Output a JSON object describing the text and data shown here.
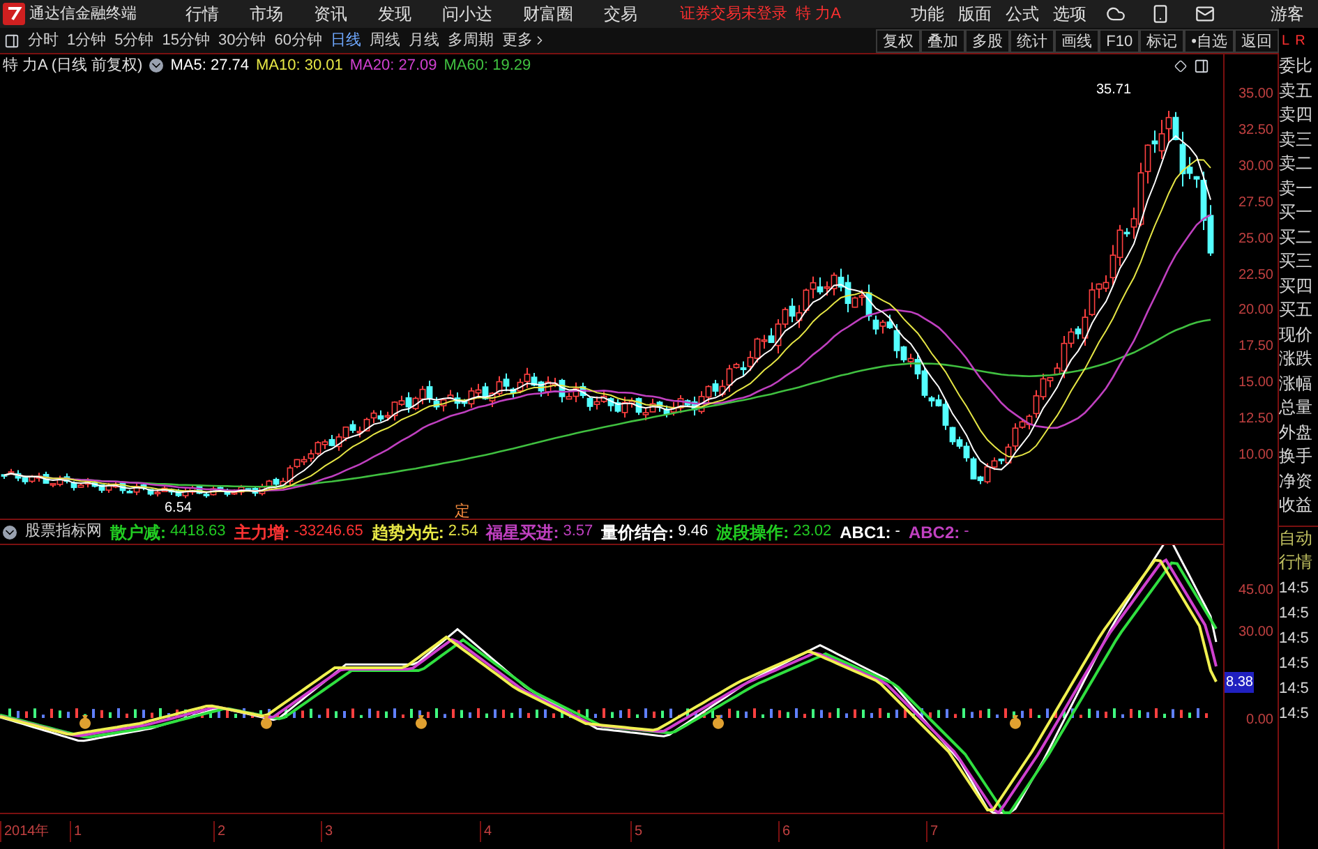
{
  "menu_bar": {
    "app_title": "通达信金融终端",
    "items": [
      "行情",
      "市场",
      "资讯",
      "发现",
      "问小达",
      "财富圈",
      "交易"
    ],
    "login_notice": "证券交易未登录",
    "stock_name": "特 力A",
    "right_items": [
      "功能",
      "版面",
      "公式",
      "选项"
    ],
    "user": "游客"
  },
  "toolbar": {
    "periods": [
      {
        "label": "分时",
        "selected": false
      },
      {
        "label": "1分钟",
        "selected": false
      },
      {
        "label": "5分钟",
        "selected": false
      },
      {
        "label": "15分钟",
        "selected": false
      },
      {
        "label": "30分钟",
        "selected": false
      },
      {
        "label": "60分钟",
        "selected": false
      },
      {
        "label": "日线",
        "selected": true
      },
      {
        "label": "周线",
        "selected": false
      },
      {
        "label": "月线",
        "selected": false
      },
      {
        "label": "多周期",
        "selected": false
      },
      {
        "label": "更多",
        "selected": false
      }
    ],
    "buttons": [
      "复权",
      "叠加",
      "多股",
      "统计",
      "画线",
      "F10",
      "标记",
      "•自选",
      "返回"
    ],
    "corner_labels": [
      "L",
      "R"
    ]
  },
  "chart_header": {
    "title": "特 力A (日线 前复权)",
    "indicators": [
      {
        "label": "MA5: 27.74",
        "color": "#ffffff"
      },
      {
        "label": "MA10: 30.01",
        "color": "#e6e645"
      },
      {
        "label": "MA20: 27.09",
        "color": "#d040d0"
      },
      {
        "label": "MA60: 19.29",
        "color": "#40c040"
      }
    ]
  },
  "annotations": {
    "high": "35.71",
    "low": "6.54",
    "marker": "定"
  },
  "price_axis": [
    "35.00",
    "32.50",
    "30.00",
    "27.50",
    "25.00",
    "22.50",
    "20.00",
    "17.50",
    "15.00",
    "12.50",
    "10.00"
  ],
  "indicator_header": {
    "name": "股票指标网",
    "values": [
      {
        "label": "散户减:",
        "value": "4418.63",
        "color": "#22cc22"
      },
      {
        "label": "主力增:",
        "value": "-33246.65",
        "color": "#ff3333"
      },
      {
        "label": "趋势为先:",
        "value": "2.54",
        "color": "#e6e645"
      },
      {
        "label": "福星买进:",
        "value": "3.57",
        "color": "#c040c0"
      },
      {
        "label": "量价结合:",
        "value": "9.46",
        "color": "#ffffff"
      },
      {
        "label": "波段操作:",
        "value": "23.02",
        "color": "#22cc22"
      },
      {
        "label": "ABC1:",
        "value": "-",
        "color": "#ffffff"
      },
      {
        "label": "ABC2:",
        "value": "-",
        "color": "#c040c0"
      }
    ]
  },
  "indicator_axis": [
    "45.00",
    "30.00",
    "0.00"
  ],
  "indicator_current": "8.38",
  "quote_labels": [
    "委比",
    "卖五",
    "卖四",
    "卖三",
    "卖二",
    "卖一",
    "买一",
    "买二",
    "买三",
    "买四",
    "买五",
    "现价",
    "涨跌",
    "涨幅",
    "总量",
    "外盘",
    "换手",
    "净资",
    "收益"
  ],
  "side_tabs": [
    "自动",
    "行情"
  ],
  "trade_times": [
    "14:5",
    "14:5",
    "14:5",
    "14:5",
    "14:5",
    "14:5"
  ],
  "date_axis": [
    "2014年",
    "1",
    "2",
    "3",
    "4",
    "5",
    "6",
    "7"
  ]
}
